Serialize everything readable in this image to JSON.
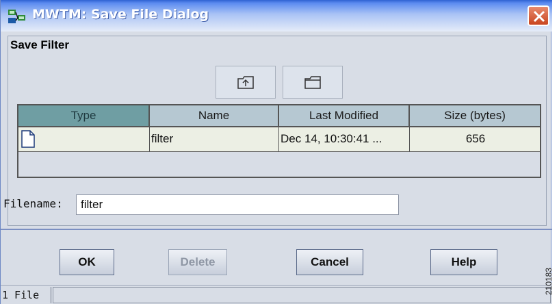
{
  "window": {
    "title": "MWTM: Save File Dialog"
  },
  "group": {
    "title": "Save Filter"
  },
  "toolbar": {
    "up_icon": "up-folder-icon",
    "new_folder_icon": "new-folder-icon"
  },
  "table": {
    "columns": [
      "Type",
      "Name",
      "Last Modified",
      "Size (bytes)"
    ],
    "rows": [
      {
        "type_icon": "file-icon",
        "name": "filter",
        "last_modified": "Dec 14, 10:30:41 ...",
        "size": "656"
      }
    ]
  },
  "filename": {
    "label": "Filename:",
    "value": "filter"
  },
  "buttons": {
    "ok": "OK",
    "delete": "Delete",
    "cancel": "Cancel",
    "help": "Help"
  },
  "status": {
    "count": "1 File"
  },
  "side_code": "210183",
  "colors": {
    "title_blue": "#2f62d3",
    "close_red": "#c94520",
    "selected_header": "#6f9ea3"
  }
}
